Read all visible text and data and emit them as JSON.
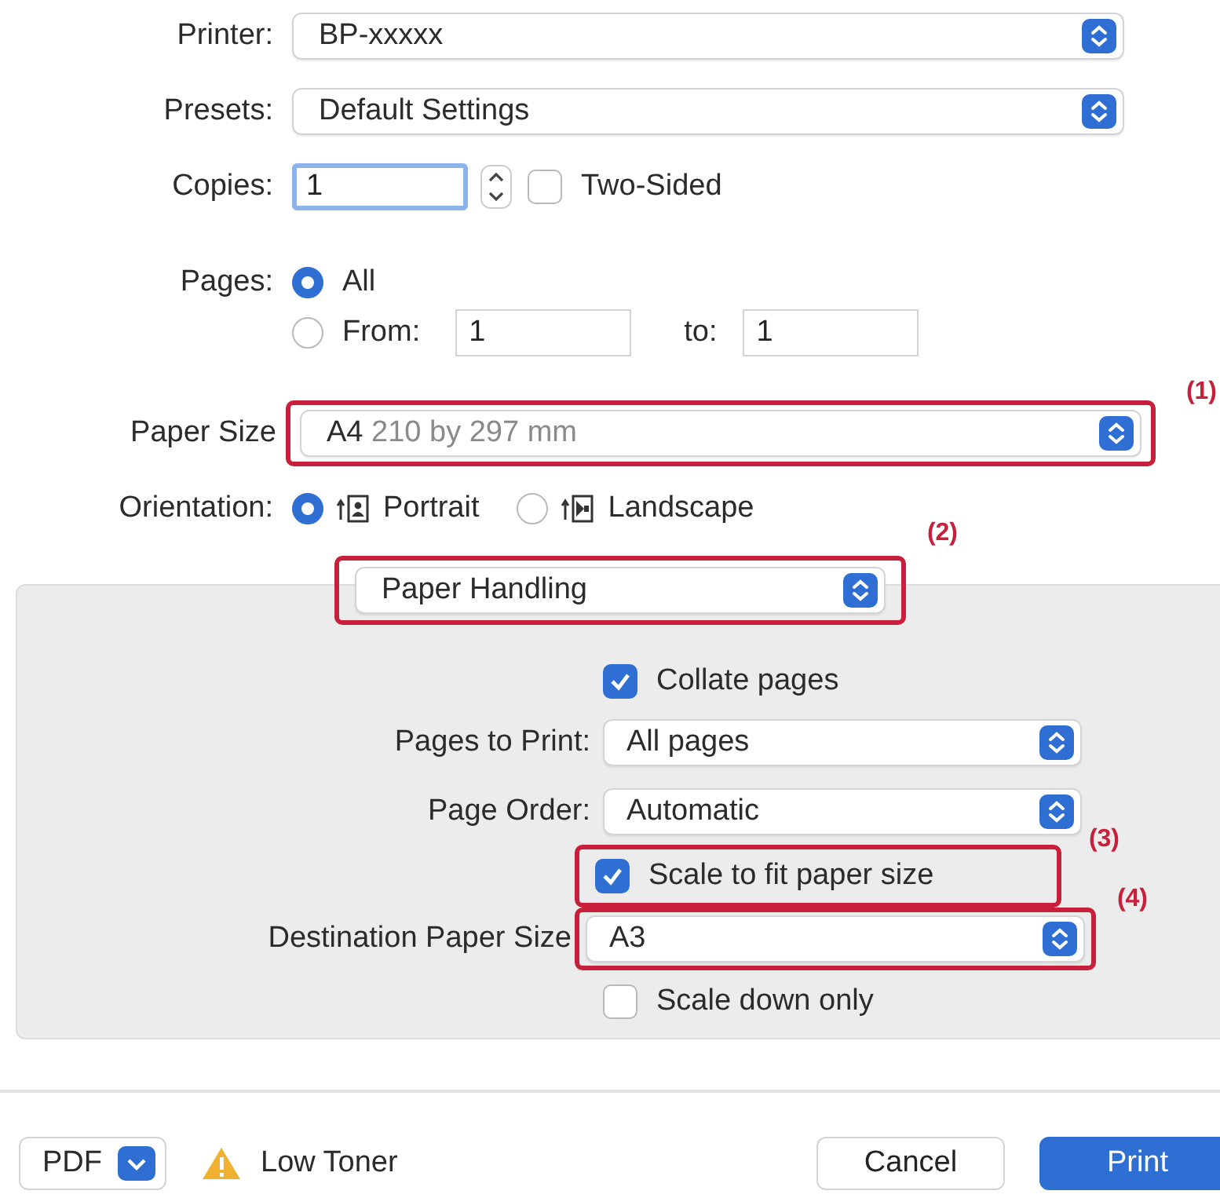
{
  "printer": {
    "label": "Printer:",
    "value": "BP-xxxxx"
  },
  "presets": {
    "label": "Presets:",
    "value": "Default Settings"
  },
  "copies": {
    "label": "Copies:",
    "value": "1",
    "two_sided": {
      "label": "Two-Sided",
      "checked": false
    }
  },
  "pages": {
    "label": "Pages:",
    "options": [
      {
        "label": "All",
        "selected": true
      },
      {
        "label": "From:",
        "selected": false
      }
    ],
    "from": "1",
    "to_label": "to:",
    "to": "1"
  },
  "paper_size": {
    "label": "Paper Size",
    "value": "A4",
    "detail": "210 by 297 mm",
    "callout": "(1)"
  },
  "orientation": {
    "label": "Orientation:",
    "options": [
      {
        "label": "Portrait",
        "selected": true,
        "kind": "portrait"
      },
      {
        "label": "Landscape",
        "selected": false,
        "kind": "landscape"
      }
    ]
  },
  "section_menu": {
    "value": "Paper Handling",
    "callout": "(2)"
  },
  "panel": {
    "items": [
      {
        "kind": "checkbox",
        "label": "Collate pages",
        "checked": true
      },
      {
        "kind": "select",
        "label": "Pages to Print:",
        "value": "All pages"
      },
      {
        "kind": "select",
        "label": "Page Order:",
        "value": "Automatic"
      },
      {
        "kind": "checkbox",
        "label": "Scale to fit paper size",
        "checked": true,
        "callout": "(3)"
      },
      {
        "kind": "select",
        "label": "Destination Paper Size",
        "value": "A3",
        "callout": "(4)"
      },
      {
        "kind": "checkbox",
        "label": "Scale down only",
        "checked": false
      }
    ]
  },
  "footer": {
    "pdf": "PDF",
    "warning": "Low Toner",
    "buttons": [
      {
        "label": "Cancel",
        "kind": "secondary"
      },
      {
        "label": "Print",
        "kind": "primary"
      }
    ]
  }
}
